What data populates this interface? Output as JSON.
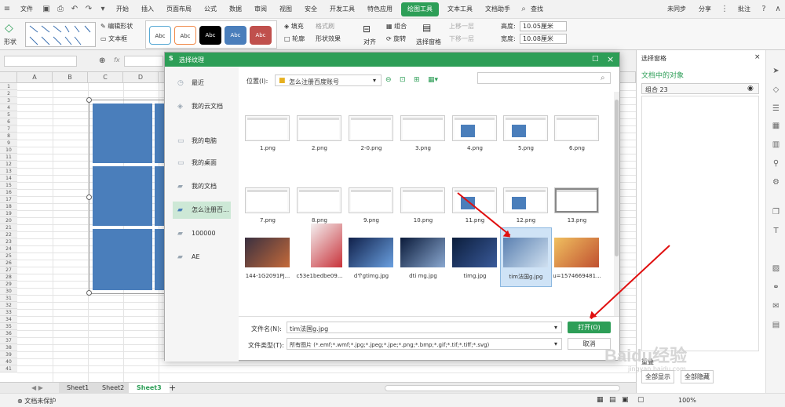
{
  "menubar": {
    "file": "文件",
    "tabs": [
      "开始",
      "插入",
      "页面布局",
      "公式",
      "数据",
      "审阅",
      "视图",
      "安全",
      "开发工具",
      "特色应用",
      "绘图工具",
      "文本工具",
      "文档助手"
    ],
    "active_tab": "绘图工具",
    "search": "查找",
    "sync": "未同步",
    "share": "分享",
    "comment": "批注"
  },
  "ribbon": {
    "shape": "形状",
    "edit_shape": "编辑形状",
    "textbox": "文本框",
    "style_labels": [
      "Abc",
      "Abc",
      "Abc",
      "Abc",
      "Abc"
    ],
    "fill": "填充",
    "outline": "轮廓",
    "format_brush": "格式刷",
    "shape_effect": "形状效果",
    "align": "对齐",
    "group": "组合",
    "rotate": "旋转",
    "select_pane": "选择窗格",
    "up_layer": "上移一层",
    "down_layer": "下移一层",
    "height_label": "高度:",
    "height_val": "10.05厘米",
    "width_label": "宽度:",
    "width_val": "10.08厘米"
  },
  "formula": {
    "fx": "fx"
  },
  "sheet": {
    "cols": [
      "A",
      "B",
      "C",
      "D"
    ],
    "rows": [
      "1",
      "2",
      "3",
      "4",
      "5",
      "6",
      "7",
      "8",
      "9",
      "10",
      "11",
      "12",
      "13",
      "14",
      "15",
      "16",
      "17",
      "18",
      "19",
      "20",
      "21",
      "22",
      "23",
      "24",
      "25",
      "26",
      "27",
      "28",
      "29",
      "30",
      "31",
      "32",
      "33",
      "34",
      "35",
      "36",
      "37",
      "38",
      "39",
      "40",
      "41"
    ],
    "tabs": [
      "Sheet1",
      "Sheet2",
      "Sheet3"
    ],
    "active_tab": "Sheet3"
  },
  "status": {
    "protect": "文档未保护",
    "zoom": "100%"
  },
  "rpane": {
    "title": "选择窗格",
    "subtitle": "文档中的对象",
    "item": "组合 23",
    "show_all": "全部显示",
    "hide_all": "全部隐藏",
    "footer_label": "重叠"
  },
  "dialog": {
    "title": "选择纹理",
    "nav": [
      "最近",
      "我的云文档",
      "我的电脑",
      "我的桌面",
      "我的文档",
      "怎么注册百...",
      "100000",
      "AE"
    ],
    "active_nav": "怎么注册百...",
    "location_label": "位置(I):",
    "location_value": "怎么注册百度账号",
    "files": [
      "1.png",
      "2.png",
      "2-0.png",
      "3.png",
      "4.png",
      "5.png",
      "6.png",
      "7.png",
      "8.png",
      "9.png",
      "10.png",
      "11.png",
      "12.png",
      "13.png",
      "144-1G2091PJ...",
      "c53e1bedbe09...",
      "d'f'gtimg.jpg",
      "dti mg.jpg",
      "timg.jpg",
      "tim法国g.jpg",
      "u=1574669481..."
    ],
    "selected_file": "tim法国g.jpg",
    "filename_label": "文件名(N):",
    "filename_value": "tim法国g.jpg",
    "filetype_label": "文件类型(T):",
    "filetype_value": "所有图片 (*.emf;*.wmf;*.jpg;*.jpeg;*.jpe;*.png;*.bmp;*.gif;*.tif;*.tiff;*.svg)",
    "open": "打开(O)",
    "cancel": "取消"
  },
  "watermark": {
    "text": "Baidu经验",
    "sub": "jingyan.baidu.com"
  },
  "colors": {
    "accent": "#2d9e57",
    "shape_blue": "#4a7ebb",
    "arrow": "#e01010"
  }
}
